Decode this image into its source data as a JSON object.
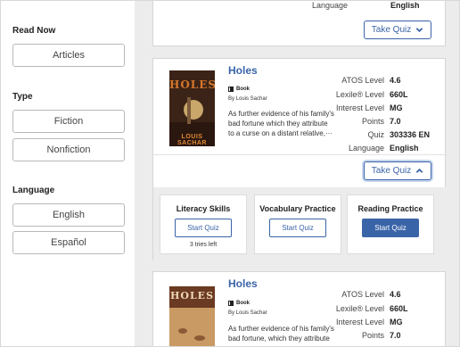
{
  "sidebar": {
    "read_now": {
      "title": "Read Now",
      "options": [
        "Articles"
      ]
    },
    "type": {
      "title": "Type",
      "options": [
        "Fiction",
        "Nonfiction"
      ]
    },
    "language": {
      "title": "Language",
      "options": [
        "English",
        "Español"
      ]
    }
  },
  "labels": {
    "atos": "ATOS Level",
    "lexile": "Lexile® Level",
    "interest": "Interest Level",
    "points": "Points",
    "quiz": "Quiz",
    "language": "Language",
    "take_quiz": "Take Quiz"
  },
  "top_card": {
    "language_value": "English"
  },
  "book1": {
    "title": "Holes",
    "format": "Book",
    "author": "By Louis Sachar",
    "summary": "As further evidence of his family's bad fortune which they attribute to a curse on a distant relative,···",
    "cover_title": "HOLES",
    "cover_author": "LOUIS SACHAR",
    "atos": "4.6",
    "lexile": "660L",
    "interest": "MG",
    "points": "7.0",
    "quiz": "303336 EN",
    "language": "English"
  },
  "practice": {
    "literacy": {
      "title": "Literacy Skills",
      "button": "Start Quiz",
      "note": "3 tries left"
    },
    "vocabulary": {
      "title": "Vocabulary Practice",
      "button": "Start Quiz"
    },
    "reading": {
      "title": "Reading Practice",
      "button": "Start Quiz"
    }
  },
  "book2": {
    "title": "Holes",
    "format": "Book",
    "author": "By Louis Sachar",
    "summary": "As further evidence of his family's bad fortune, which they attribute",
    "cover_title": "HOLES",
    "atos": "4.6",
    "lexile": "660L",
    "interest": "MG",
    "points": "7.0"
  },
  "colors": {
    "accent": "#3a64a8",
    "background": "#ececec"
  },
  "icons": {
    "expand": "chevron-down-icon",
    "collapse": "chevron-up-icon",
    "format": "book-icon"
  }
}
